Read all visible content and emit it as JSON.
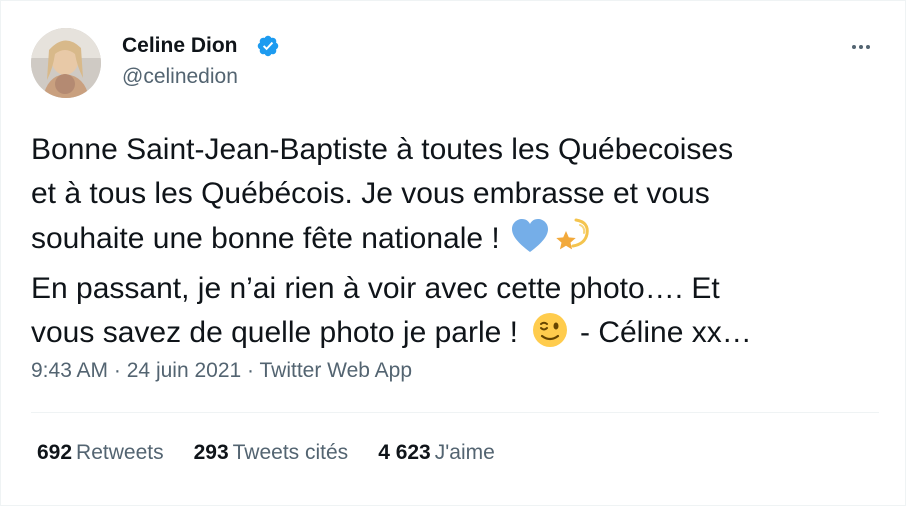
{
  "author": {
    "display_name": "Celine Dion",
    "handle": "@celinedion",
    "verified": true
  },
  "tweet": {
    "lines": [
      "Bonne Saint-Jean-Baptiste à toutes les Québecoises",
      "et à tous les Québécois. Je vous embrasse et vous",
      "souhaite une bonne fête nationale !",
      "En passant, je n’ai rien à voir avec cette photo…. Et",
      "vous savez de quelle photo je parle !",
      "- Céline xx…"
    ],
    "emojis": [
      "blue-heart",
      "dizzy-star",
      "winking-face"
    ]
  },
  "meta": {
    "time": "9:43 AM",
    "separator": "·",
    "date": "24 juin 2021",
    "source": "Twitter Web App"
  },
  "stats": {
    "retweets": {
      "count": "692",
      "label": "Retweets"
    },
    "quotes": {
      "count": "293",
      "label": "Tweets cités"
    },
    "likes": {
      "count": "4 623",
      "label": "J'aime"
    }
  },
  "colors": {
    "text": "#0f1419",
    "secondary": "#536471",
    "verified": "#1d9bf0",
    "divider": "#eff3f4"
  }
}
